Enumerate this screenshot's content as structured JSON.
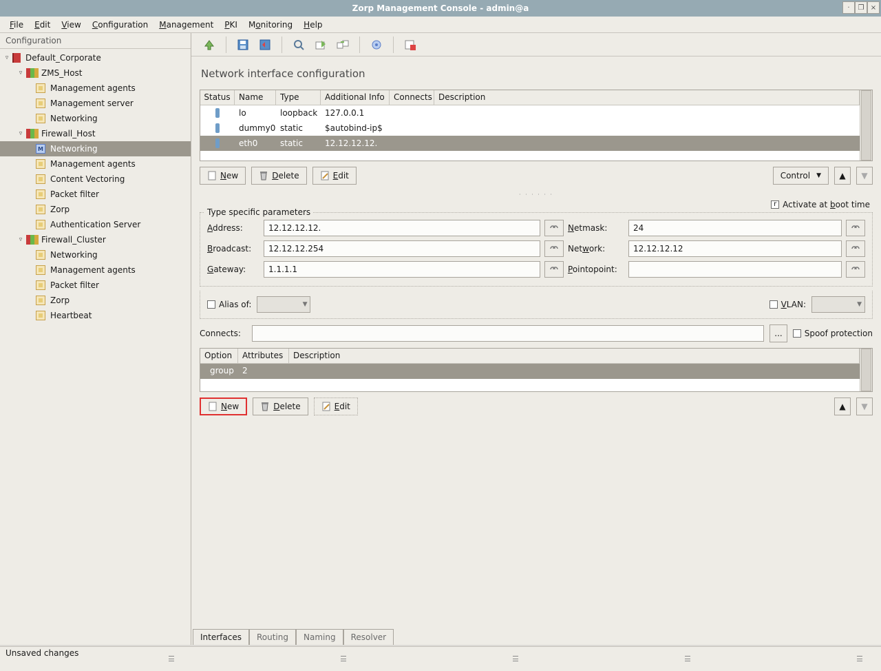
{
  "window": {
    "title": "Zorp Management Console - admin@a"
  },
  "menu": {
    "file": "File",
    "edit": "Edit",
    "view": "View",
    "configuration": "Configuration",
    "management": "Management",
    "pki": "PKI",
    "monitoring": "Monitoring",
    "help": "Help"
  },
  "sidebar": {
    "title": "Configuration",
    "site": "Default_Corporate",
    "hosts": {
      "zms": {
        "label": "ZMS_Host",
        "children": [
          "Management agents",
          "Management server",
          "Networking"
        ]
      },
      "fw": {
        "label": "Firewall_Host",
        "children": [
          "Networking",
          "Management agents",
          "Content Vectoring",
          "Packet filter",
          "Zorp",
          "Authentication Server"
        ]
      },
      "cluster": {
        "label": "Firewall_Cluster",
        "children": [
          "Networking",
          "Management agents",
          "Packet filter",
          "Zorp",
          "Heartbeat"
        ]
      }
    }
  },
  "panel": {
    "title": "Network interface configuration"
  },
  "iface_table": {
    "headers": {
      "status": "Status",
      "name": "Name",
      "type": "Type",
      "addl": "Additional Info",
      "connects": "Connects",
      "desc": "Description"
    },
    "rows": [
      {
        "name": "lo",
        "type": "loopback",
        "addl": "127.0.0.1"
      },
      {
        "name": "dummy0",
        "type": "static",
        "addl": "$autobind-ip$"
      },
      {
        "name": "eth0",
        "type": "static",
        "addl": "12.12.12.12."
      }
    ]
  },
  "buttons": {
    "new": "New",
    "delete": "Delete",
    "edit": "Edit",
    "control": "Control"
  },
  "boot": {
    "label": "Activate at boot time"
  },
  "form": {
    "legend": "Type specific parameters",
    "address_label": "Address:",
    "address": "12.12.12.12.",
    "netmask_label": "Netmask:",
    "netmask": "24",
    "broadcast_label": "Broadcast:",
    "broadcast": "12.12.12.254",
    "network_label": "Network:",
    "network": "12.12.12.12",
    "gateway_label": "Gateway:",
    "gateway": "1.1.1.1",
    "ptp_label": "Pointopoint:",
    "ptp": ""
  },
  "alias": {
    "label": "Alias of:",
    "vlan": "VLAN:"
  },
  "connects": {
    "label": "Connects:",
    "spoof": "Spoof protection",
    "browse": "..."
  },
  "opt_table": {
    "headers": {
      "option": "Option",
      "attributes": "Attributes",
      "desc": "Description"
    },
    "row": {
      "option": "group",
      "attributes": "2"
    }
  },
  "tabs": {
    "interfaces": "Interfaces",
    "routing": "Routing",
    "naming": "Naming",
    "resolver": "Resolver"
  },
  "statusbar": {
    "text": "Unsaved changes"
  }
}
